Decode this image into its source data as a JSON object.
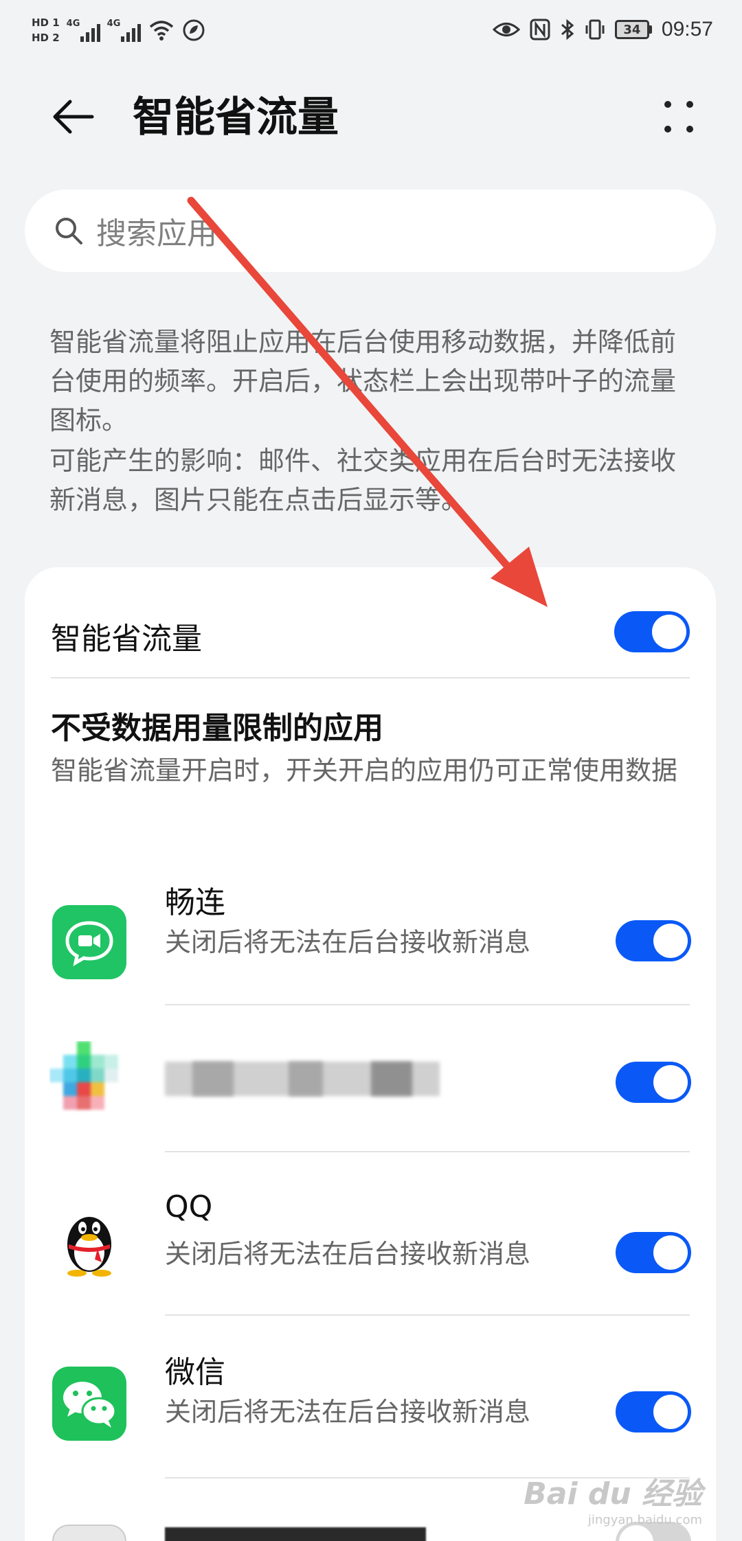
{
  "status_bar": {
    "hd1": "HD 1",
    "hd2": "HD 2",
    "net1": "4G",
    "net2": "4G",
    "battery": "34",
    "time": "09:57"
  },
  "header": {
    "title": "智能省流量"
  },
  "search": {
    "placeholder": "搜索应用"
  },
  "description": {
    "line1": "智能省流量将阻止应用在后台使用移动数据，并降低前台使用的频率。开启后，状态栏上会出现带叶子的流量图标。",
    "line2": "可能产生的影响：邮件、社交类应用在后台时无法接收新消息，图片只能在点击后显示等。"
  },
  "main_toggle": {
    "label": "智能省流量",
    "on": true
  },
  "unrestricted": {
    "title": "不受数据用量限制的应用",
    "subtitle": "智能省流量开启时，开关开启的应用仍可正常使用数据"
  },
  "apps": [
    {
      "name": "畅连",
      "subtitle": "关闭后将无法在后台接收新消息",
      "on": true,
      "icon": "changlian-icon"
    },
    {
      "name": "",
      "subtitle": "",
      "on": true,
      "icon": "blurred-app-icon"
    },
    {
      "name": "QQ",
      "subtitle": "关闭后将无法在后台接收新消息",
      "on": true,
      "icon": "qq-penguin-icon"
    },
    {
      "name": "微信",
      "subtitle": "关闭后将无法在后台接收新消息",
      "on": true,
      "icon": "wechat-icon"
    },
    {
      "name": "",
      "subtitle": "",
      "on": false,
      "icon": "keyboard-app-icon"
    }
  ],
  "colors": {
    "accent": "#0a59f7",
    "background": "#f1f3f5",
    "annotation_arrow": "#e8473a"
  },
  "watermark": {
    "brand": "Bai du 经验",
    "url": "jingyan.baidu.com"
  }
}
